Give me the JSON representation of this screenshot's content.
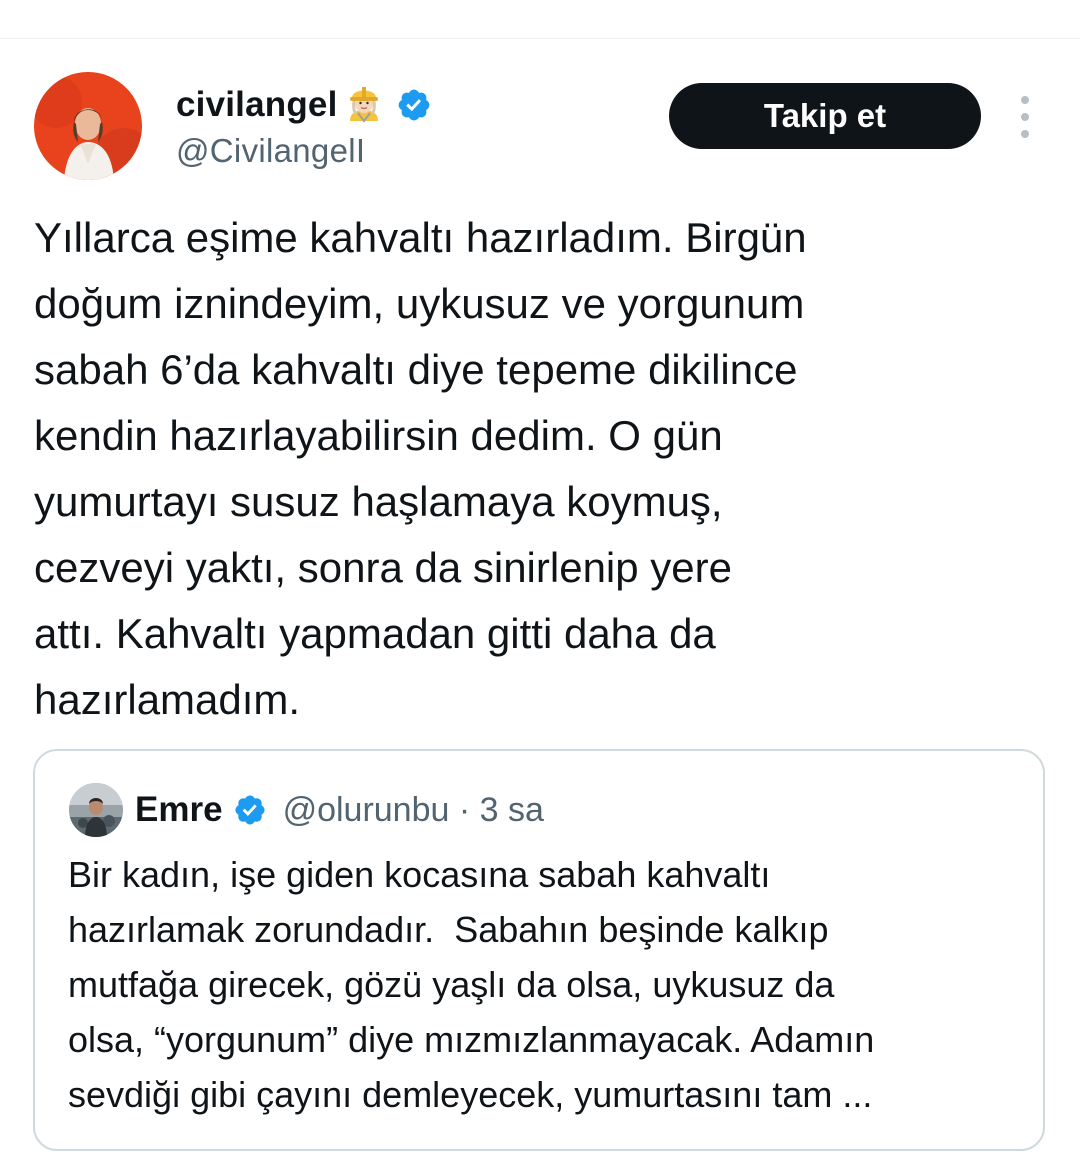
{
  "tweet": {
    "author": {
      "display_name": "civilangel",
      "emoji": "construction-worker-woman-emoji",
      "verified": true,
      "handle": "@CivilangelI"
    },
    "follow_label": "Takip et",
    "text_lines": [
      "Yıllarca eşime kahvaltı hazırladım. Birgün",
      "doğum iznindeyim, uykusuz ve yorgunum",
      "sabah 6’da kahvaltı diye tepeme dikilince",
      "kendin hazırlayabilirsin dedim. O gün",
      "yumurtayı susuz haşlamaya koymuş,",
      "cezveyi yaktı, sonra da sinirlenip yere",
      "attı. Kahvaltı yapmadan gitti daha da",
      "hazırlamadım."
    ]
  },
  "quoted_tweet": {
    "author": {
      "display_name": "Emre",
      "verified": true,
      "handle": "@olurunbu",
      "time": "3 sa"
    },
    "text_lines": [
      "Bir kadın, işe giden kocasına sabah kahvaltı",
      "hazırlamak zorundadır.  Sabahın beşinde kalkıp",
      "mutfağa girecek, gözü yaşlı da olsa, uykusuz da",
      "olsa, “yorgunum” diye mızmızlanmayacak. Adamın",
      "sevdiği gibi çayını demleyecek, yumurtasını tam ..."
    ]
  },
  "colors": {
    "text": "#0f1419",
    "secondary": "#536471",
    "verified": "#1d9bf0",
    "button_bg": "#0f1419",
    "border": "#cfd9de",
    "avatar_bg": "#e8431c"
  },
  "icons": [
    "verified-badge-icon",
    "more-options-icon"
  ]
}
